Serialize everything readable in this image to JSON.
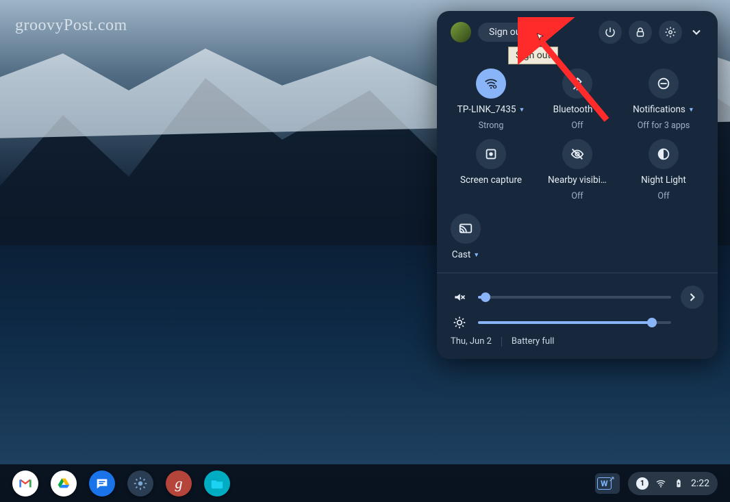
{
  "watermark": "groovyPost.com",
  "panel": {
    "signout_label": "Sign out",
    "tooltip": "Sign out",
    "tiles": [
      {
        "label": "TP-LINK_7435",
        "sub": "Strong",
        "active": true
      },
      {
        "label": "Bluetooth",
        "sub": "Off",
        "active": false
      },
      {
        "label": "Notifications",
        "sub": "Off for 3 apps",
        "active": false
      },
      {
        "label": "Screen capture",
        "sub": "",
        "active": false
      },
      {
        "label": "Nearby visibi…",
        "sub": "Off",
        "active": false
      },
      {
        "label": "Night Light",
        "sub": "Off",
        "active": false
      }
    ],
    "cast_label": "Cast",
    "volume_percent": 4,
    "brightness_percent": 90,
    "date": "Thu, Jun 2",
    "battery": "Battery full"
  },
  "shelf": {
    "notif_count": "1",
    "clock": "2:22"
  }
}
